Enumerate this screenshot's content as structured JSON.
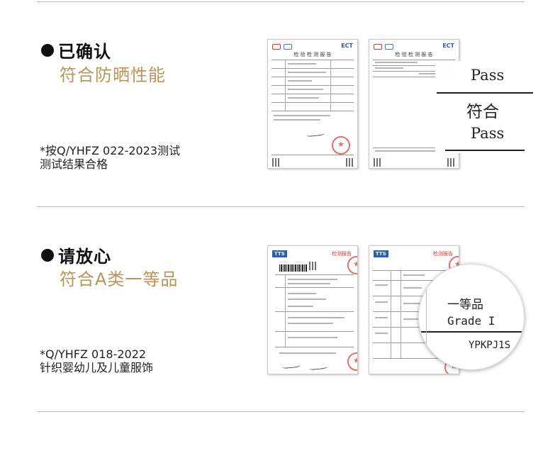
{
  "section1": {
    "headline": "已确认",
    "subhead": "符合防晒性能",
    "note_line1": "*按Q/YHFZ 022-2023测试",
    "note_line2": "测试结果合格",
    "report_brand": "ECT",
    "report_title": "检 验 检 测 报 告",
    "callout": {
      "top": "Pass",
      "middle": "符合",
      "bottom": "Pass"
    }
  },
  "section2": {
    "headline": "请放心",
    "subhead": "符合A类一等品",
    "note_line1": "*Q/YHFZ 018-2022",
    "note_line2": "针织婴幼儿及儿童服饰",
    "report_brand": "TTS",
    "report_title": "检测报告",
    "callout": {
      "top": "一等品",
      "middle": "Grade I",
      "bottom": "YPKPJ1S"
    }
  },
  "colors": {
    "accent": "#b8955a",
    "seal": "#e04a4a",
    "divider": "#bdbdbd"
  }
}
